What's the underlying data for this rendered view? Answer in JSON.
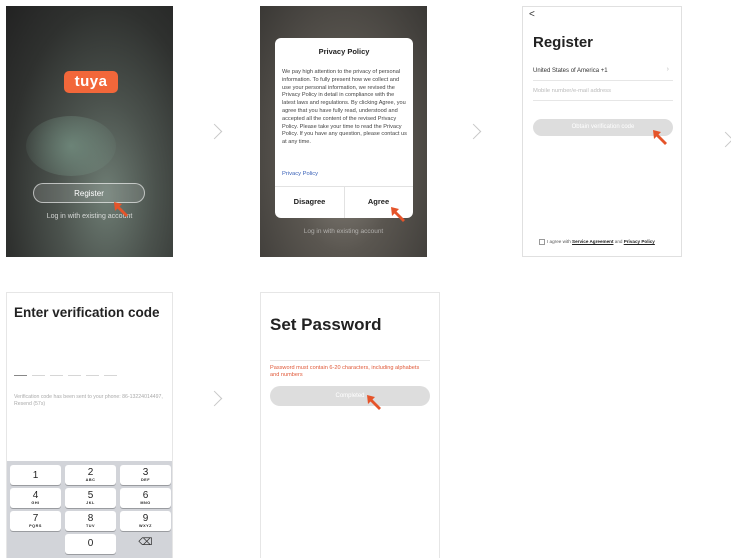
{
  "screen1": {
    "logo": "tuya",
    "register_button": "Register",
    "login_link": "Log in with existing account"
  },
  "screen2": {
    "dialog_title": "Privacy Policy",
    "dialog_body": "We pay high attention to the privacy of personal information. To fully present how we collect and use your personal information, we revised the Privacy Policy in detail in compliance with the latest laws and regulations. By clicking Agree, you agree that you have fully read, understood and accepted all the content of the revised Privacy Policy. Please take your time to read the Privacy Policy. If you have any question, please contact us at any time.",
    "policy_link": "Privacy Policy",
    "disagree_button": "Disagree",
    "agree_button": "Agree",
    "background_link": "Log in with existing account"
  },
  "screen3": {
    "back_glyph": "<",
    "title": "Register",
    "country": "United States of America +1",
    "input_placeholder": "Mobile number/e-mail address",
    "obtain_button": "Obtain verification code",
    "agree_prefix": "I agree with ",
    "service_agreement": "Service Agreement",
    "agree_and": " and ",
    "privacy_policy": "Privacy Policy"
  },
  "screen4": {
    "title": "Enter verification code",
    "info": "Verification code has been sent to your phone: 86-13224014497, Resend (57s)",
    "keys": [
      {
        "digit": "1",
        "letters": ""
      },
      {
        "digit": "2",
        "letters": "ABC"
      },
      {
        "digit": "3",
        "letters": "DEF"
      },
      {
        "digit": "4",
        "letters": "GHI"
      },
      {
        "digit": "5",
        "letters": "JKL"
      },
      {
        "digit": "6",
        "letters": "MNO"
      },
      {
        "digit": "7",
        "letters": "PQRS"
      },
      {
        "digit": "8",
        "letters": "TUV"
      },
      {
        "digit": "9",
        "letters": "WXYZ"
      },
      {
        "digit": "0",
        "letters": ""
      }
    ],
    "delete_glyph": "⌫"
  },
  "screen5": {
    "title": "Set Password",
    "hint": "Password must contain 6-20 characters, including alphabets and numbers",
    "completed_button": "Completed"
  },
  "colors": {
    "brand": "#f2673a",
    "pointer_arrow": "#e5542a",
    "disabled_button": "#dddddd",
    "link": "#3a62b8"
  }
}
